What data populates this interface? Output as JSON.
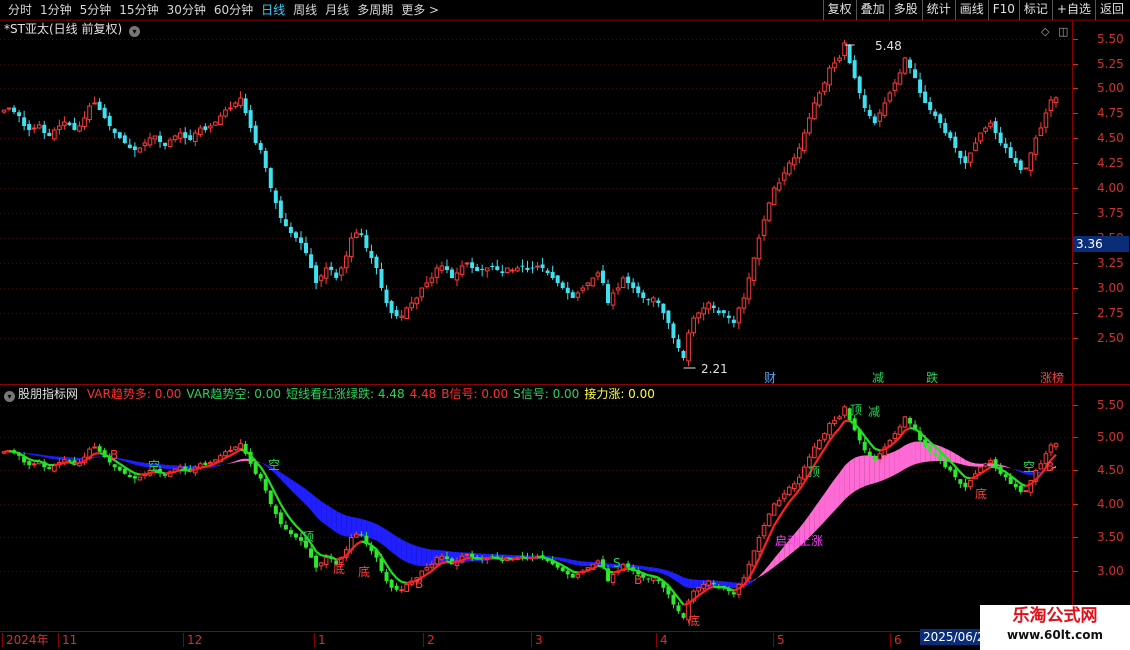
{
  "toolbar": {
    "periods": [
      "分时",
      "1分钟",
      "5分钟",
      "15分钟",
      "30分钟",
      "60分钟",
      "日线",
      "周线",
      "月线",
      "多周期",
      "更多 >"
    ],
    "active_period": "日线",
    "right_tools": [
      "复权",
      "叠加",
      "多股",
      "统计",
      "画线",
      "F10",
      "标记",
      "+自选",
      "返回"
    ]
  },
  "main_pane": {
    "title": "*ST亚太(日线 前复权)",
    "high_label": "5.48",
    "low_label": "2.21",
    "current_price": "3.36",
    "y_ticks": [
      "5.50",
      "5.25",
      "5.00",
      "4.75",
      "4.50",
      "4.25",
      "4.00",
      "3.75",
      "3.50",
      "3.25",
      "3.00",
      "2.75",
      "2.50"
    ],
    "events": [
      {
        "text": "财",
        "color": "#4da3ff"
      },
      {
        "text": "减",
        "color": "#29d45b"
      },
      {
        "text": "跌",
        "color": "#29d45b"
      },
      {
        "text": "涨榜",
        "color": "#ff4040"
      }
    ]
  },
  "indicator_pane": {
    "name": "股朋指标网",
    "values": [
      {
        "text": "VAR趋势多: 0.00",
        "color": "#ff3030"
      },
      {
        "text": "VAR趋势空: 0.00",
        "color": "#29d45b"
      },
      {
        "text": "短线看红涨绿跌: 4.48",
        "color": "#29d45b"
      },
      {
        "text": "4.48",
        "color": "#ff3030"
      },
      {
        "text": "B信号: 0.00",
        "color": "#ff3030"
      },
      {
        "text": "S信号: 0.00",
        "color": "#29d45b"
      },
      {
        "text": "接力涨: 0.00",
        "color": "#ffff40"
      }
    ],
    "y_ticks": [
      "5.50",
      "5.00",
      "4.50",
      "4.00",
      "3.50",
      "3.00"
    ],
    "annotations": [
      {
        "text": "B",
        "color": "#ff4040"
      },
      {
        "text": "空",
        "color": "#29d45b"
      },
      {
        "text": "空",
        "color": "#29d45b"
      },
      {
        "text": "顶",
        "color": "#29d45b"
      },
      {
        "text": "底",
        "color": "#ff4040"
      },
      {
        "text": "底",
        "color": "#ff4040"
      },
      {
        "text": "B",
        "color": "#ff4040"
      },
      {
        "text": "S",
        "color": "#29d45b"
      },
      {
        "text": "B",
        "color": "#ff4040"
      },
      {
        "text": "底",
        "color": "#ff4040"
      },
      {
        "text": "启动上涨",
        "color": "#ff40ff"
      },
      {
        "text": "顶",
        "color": "#29d45b"
      },
      {
        "text": "顶",
        "color": "#29d45b"
      },
      {
        "text": "减",
        "color": "#29d45b"
      },
      {
        "text": "底",
        "color": "#ff4040"
      },
      {
        "text": "空",
        "color": "#29d45b"
      },
      {
        "text": "B",
        "color": "#ff4040"
      }
    ]
  },
  "date_axis": {
    "labels": [
      "2024年",
      "11",
      "12",
      "1",
      "2",
      "3",
      "4",
      "5",
      "6"
    ],
    "current_date": "2025/06/2"
  },
  "watermark": {
    "line1": "乐淘公式网",
    "line2": "www.60lt.com"
  },
  "chart_data": {
    "type": "candlestick",
    "series": [
      {
        "values": [
          4.78,
          4.8,
          4.76,
          4.72,
          4.62,
          4.58,
          4.6,
          4.63,
          4.55,
          4.52,
          4.58,
          4.62,
          4.66,
          4.63,
          4.58,
          4.62,
          4.7,
          4.82,
          4.85,
          4.78,
          4.7,
          4.62,
          4.55,
          4.5,
          4.45,
          4.4,
          4.38,
          4.4,
          4.45,
          4.5,
          4.52,
          4.46,
          4.42,
          4.48,
          4.52,
          4.55,
          4.5,
          4.48,
          4.55,
          4.6,
          4.58,
          4.62,
          4.66,
          4.72,
          4.78,
          4.8,
          4.85,
          4.9,
          4.75,
          4.6,
          4.45,
          4.38,
          4.2,
          4.0,
          3.85,
          3.7,
          3.62,
          3.55,
          3.5,
          3.45,
          3.35,
          3.2,
          3.05,
          3.12,
          3.2,
          3.18,
          3.1,
          3.2,
          3.32,
          3.5,
          3.55,
          3.53,
          3.4,
          3.3,
          3.2,
          3.0,
          2.85,
          2.75,
          2.72,
          2.72,
          2.8,
          2.85,
          2.9,
          3.0,
          3.05,
          3.1,
          3.2,
          3.22,
          3.18,
          3.1,
          3.15,
          3.22,
          3.25,
          3.2,
          3.17,
          3.18,
          3.2,
          3.22,
          3.18,
          3.15,
          3.2,
          3.18,
          3.2,
          3.22,
          3.18,
          3.2,
          3.22,
          3.2,
          3.15,
          3.1,
          3.05,
          3.0,
          2.95,
          2.9,
          2.95,
          3.0,
          3.05,
          3.1,
          3.15,
          3.05,
          2.85,
          2.95,
          3.0,
          3.1,
          3.05,
          3.0,
          2.95,
          2.9,
          2.88,
          2.9,
          2.85,
          2.75,
          2.65,
          2.5,
          2.4,
          2.3,
          2.55,
          2.7,
          2.75,
          2.8,
          2.85,
          2.8,
          2.75,
          2.75,
          2.7,
          2.65,
          2.8,
          2.9,
          3.1,
          3.3,
          3.5,
          3.68,
          3.85,
          4.0,
          4.05,
          4.15,
          4.25,
          4.3,
          4.4,
          4.55,
          4.7,
          4.85,
          4.95,
          5.05,
          5.2,
          5.25,
          5.3,
          5.45,
          5.25,
          5.1,
          4.95,
          4.8,
          4.72,
          4.65,
          4.75,
          4.85,
          4.95,
          5.05,
          5.15,
          5.3,
          5.2,
          5.1,
          4.95,
          4.85,
          4.78,
          4.72,
          4.65,
          4.55,
          4.5,
          4.4,
          4.3,
          4.25,
          4.35,
          4.45,
          4.55,
          4.6,
          4.65,
          4.55,
          4.45,
          4.4,
          4.3,
          4.25,
          4.18,
          4.2,
          4.35,
          4.5,
          4.6,
          4.75,
          4.88,
          4.9
        ]
      }
    ],
    "ylim_main": [
      2.21,
      5.48
    ],
    "ylim_indicator": [
      2.9,
      5.6
    ]
  }
}
